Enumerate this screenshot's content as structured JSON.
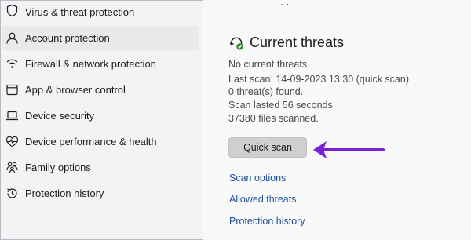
{
  "nav": {
    "items": [
      {
        "label": "Virus & threat protection",
        "icon": "shield-icon"
      },
      {
        "label": "Account protection",
        "icon": "person-icon",
        "selected": true
      },
      {
        "label": "Firewall & network protection",
        "icon": "wifi-icon"
      },
      {
        "label": "App & browser control",
        "icon": "browser-window-icon"
      },
      {
        "label": "Device security",
        "icon": "laptop-icon"
      },
      {
        "label": "Device performance & health",
        "icon": "heart-pulse-icon"
      },
      {
        "label": "Family options",
        "icon": "family-icon"
      },
      {
        "label": "Protection history",
        "icon": "history-icon"
      }
    ]
  },
  "threats": {
    "title": "Current threats",
    "icon": "threat-scan-icon",
    "status": "No current threats.",
    "last_scan": "Last scan: 14-09-2023 13:30 (quick scan)",
    "found": "0 threat(s) found.",
    "duration": "Scan lasted 56 seconds",
    "files": "37380 files scanned.",
    "scan_button": "Quick scan",
    "links": [
      "Scan options",
      "Allowed threats",
      "Protection history"
    ]
  },
  "annotation": {
    "arrow_color": "#7a1fd6"
  }
}
